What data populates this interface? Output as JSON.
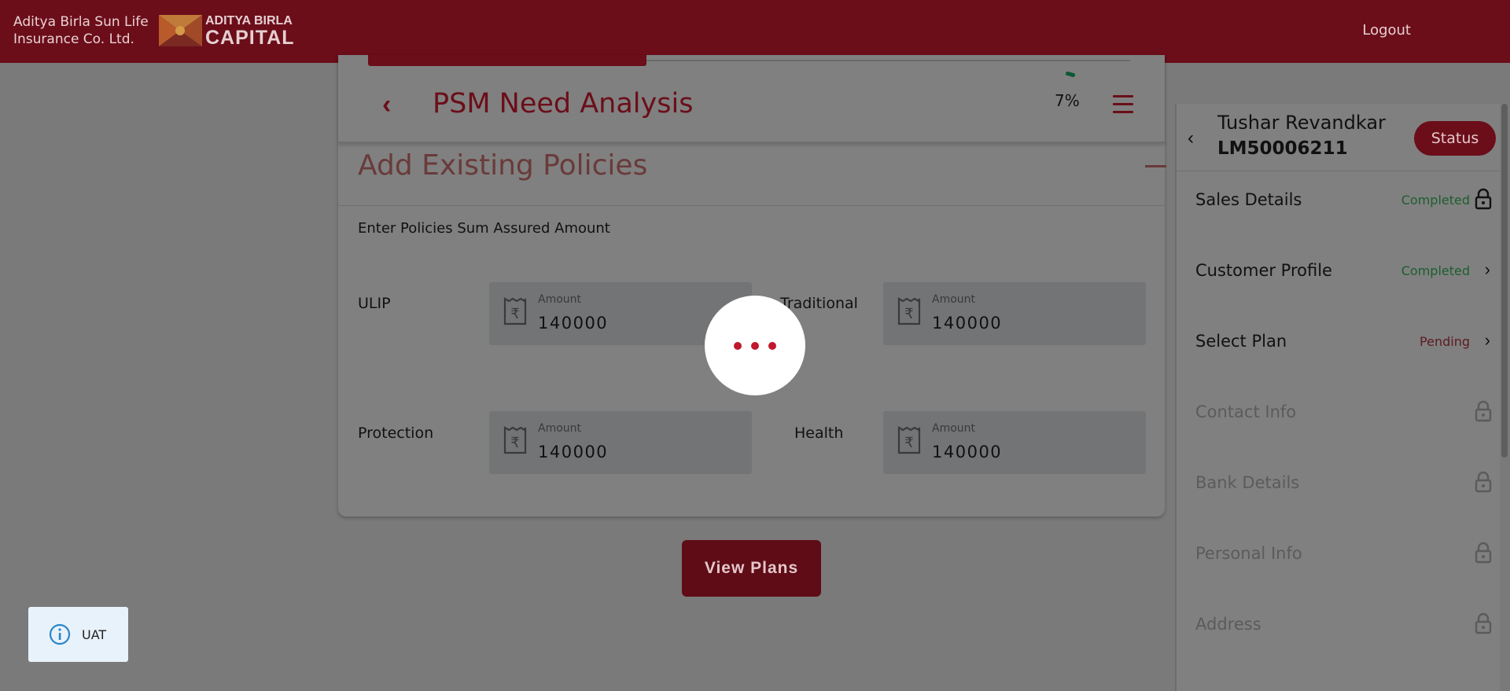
{
  "header": {
    "company_line1": "Aditya Birla Sun Life",
    "company_line2": "Insurance Co. Ltd.",
    "logo_line1": "ADITYA BIRLA",
    "logo_line2": "CAPITAL",
    "logout_label": "Logout"
  },
  "page": {
    "title": "PSM Need Analysis",
    "progress": "7%",
    "section_title": "Add Existing Policies",
    "section_subtitle": "Enter Policies Sum Assured Amount",
    "fields": [
      {
        "label": "ULIP",
        "amount_label": "Amount",
        "value": "140000"
      },
      {
        "label": "Traditional",
        "amount_label": "Amount",
        "value": "140000"
      },
      {
        "label": "Protection",
        "amount_label": "Amount",
        "value": "140000"
      },
      {
        "label": "Health",
        "amount_label": "Amount",
        "value": "140000"
      }
    ],
    "view_plans_label": "View Plans"
  },
  "sidebar": {
    "customer_name": "Tushar Revandkar",
    "lead_id": "LM50006211",
    "status_label": "Status",
    "items": [
      {
        "label": "Sales Details",
        "status": "Completed",
        "icon": "lock-icon"
      },
      {
        "label": "Customer Profile",
        "status": "Completed",
        "icon": "chevron-right-icon"
      },
      {
        "label": "Select Plan",
        "status": "Pending",
        "icon": "chevron-right-icon"
      },
      {
        "label": "Contact Info",
        "status": "",
        "icon": "lock-icon"
      },
      {
        "label": "Bank Details",
        "status": "",
        "icon": "lock-icon"
      },
      {
        "label": "Personal Info",
        "status": "",
        "icon": "lock-icon"
      },
      {
        "label": "Address",
        "status": "",
        "icon": "lock-icon"
      }
    ]
  },
  "toast": {
    "label": "UAT",
    "icon": "info-icon"
  },
  "colors": {
    "brand": "#6b0e19",
    "overlay": "#808080",
    "completed": "#1c5e2f",
    "pending": "#5d1a22",
    "loader_dot": "#c0182c"
  }
}
